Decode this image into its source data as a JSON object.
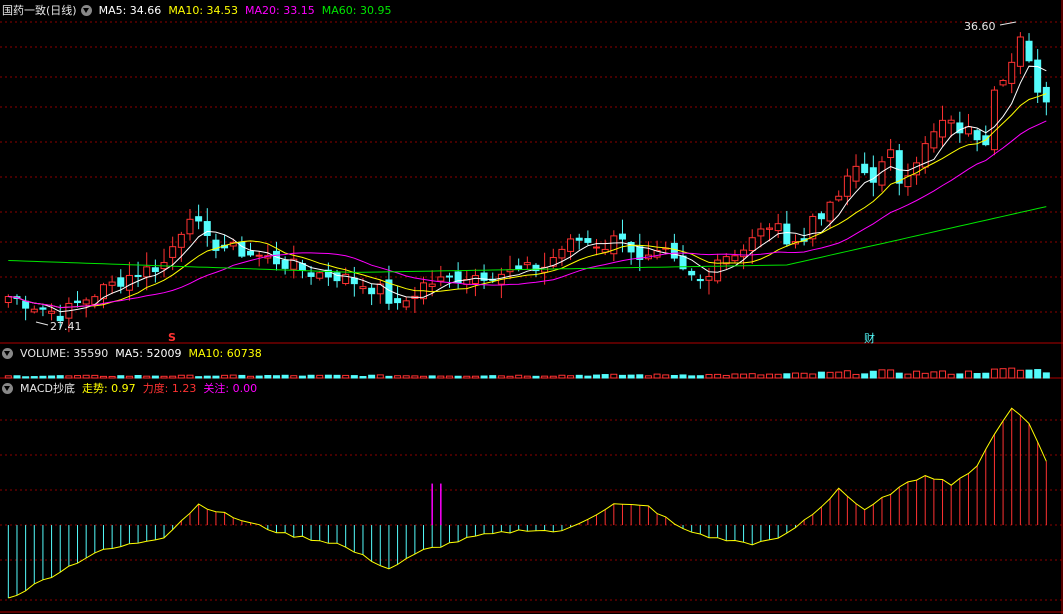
{
  "title": "国药一致(日线)",
  "legend": {
    "ma5": "MA5: 34.66",
    "ma10": "MA10: 34.53",
    "ma20": "MA20: 33.15",
    "ma60": "MA60: 30.95"
  },
  "volume_header": {
    "label": "VOLUME: 35590",
    "ma5": "MA5: 52009",
    "ma10": "MA10: 60738"
  },
  "macd_header": {
    "label": "MACD抄底",
    "trend": "走势: 0.97",
    "force": "力度: 1.23",
    "focus": "关注: 0.00"
  },
  "markers": {
    "high": "36.60",
    "low": "27.41",
    "s": "S",
    "cai": "财"
  },
  "colors": {
    "up": "#ff3232",
    "down": "#54fcfc",
    "ma5": "#ffffff",
    "ma10": "#ffff00",
    "ma20": "#ff00ff",
    "ma60": "#00e600",
    "grid": "#8b0000"
  },
  "chart_data": {
    "type": "candlestick",
    "panes": [
      "price",
      "volume",
      "macd"
    ],
    "price_range": [
      27.41,
      36.6
    ],
    "control_points": [
      [
        0,
        28.1
      ],
      [
        6,
        27.5
      ],
      [
        10,
        28.2
      ],
      [
        14,
        28.8
      ],
      [
        18,
        29.2
      ],
      [
        21,
        30.9
      ],
      [
        23,
        29.9
      ],
      [
        27,
        29.6
      ],
      [
        31,
        29.3
      ],
      [
        35,
        28.9
      ],
      [
        38,
        28.8
      ],
      [
        43,
        28.3
      ],
      [
        45,
        27.7
      ],
      [
        48,
        28.5
      ],
      [
        53,
        28.8
      ],
      [
        58,
        28.9
      ],
      [
        62,
        29.1
      ],
      [
        64,
        29.7
      ],
      [
        66,
        30.0
      ],
      [
        69,
        29.8
      ],
      [
        71,
        30.2
      ],
      [
        73,
        29.2
      ],
      [
        76,
        29.5
      ],
      [
        78,
        28.9
      ],
      [
        80,
        28.6
      ],
      [
        82,
        29.4
      ],
      [
        85,
        29.7
      ],
      [
        88,
        30.5
      ],
      [
        90,
        30.1
      ],
      [
        92,
        29.9
      ],
      [
        93,
        30.8
      ],
      [
        95,
        31.0
      ],
      [
        98,
        32.4
      ],
      [
        100,
        32.1
      ],
      [
        102,
        32.8
      ],
      [
        103,
        32.0
      ],
      [
        106,
        33.1
      ],
      [
        108,
        33.9
      ],
      [
        110,
        33.7
      ],
      [
        113,
        33.4
      ],
      [
        114,
        35.2
      ],
      [
        116,
        35.9
      ],
      [
        117,
        36.6
      ],
      [
        118,
        35.8
      ],
      [
        119,
        35.1
      ],
      [
        120,
        34.6
      ]
    ],
    "volume": {
      "last": 35590,
      "ma5": 52009,
      "ma10": 60738,
      "shape": [
        [
          0,
          0.12
        ],
        [
          60,
          0.15
        ],
        [
          90,
          0.22
        ],
        [
          100,
          0.38
        ],
        [
          110,
          0.32
        ],
        [
          116,
          0.5
        ],
        [
          120,
          0.45
        ]
      ]
    },
    "macd": {
      "trend": 0.97,
      "force": 1.23,
      "focus": 0.0,
      "line": [
        [
          0,
          -3.2
        ],
        [
          5,
          -2.2
        ],
        [
          10,
          -1.2
        ],
        [
          18,
          -0.5
        ],
        [
          22,
          0.9
        ],
        [
          27,
          0.2
        ],
        [
          32,
          -0.4
        ],
        [
          38,
          -0.8
        ],
        [
          44,
          -1.9
        ],
        [
          48,
          -1.1
        ],
        [
          54,
          -0.5
        ],
        [
          60,
          -0.2
        ],
        [
          64,
          -0.3
        ],
        [
          68,
          0.5
        ],
        [
          70,
          0.9
        ],
        [
          74,
          0.8
        ],
        [
          78,
          -0.2
        ],
        [
          82,
          -0.6
        ],
        [
          86,
          -0.8
        ],
        [
          88,
          -0.7
        ],
        [
          90,
          -0.4
        ],
        [
          94,
          0.8
        ],
        [
          96,
          1.6
        ],
        [
          99,
          0.6
        ],
        [
          102,
          1.4
        ],
        [
          104,
          1.8
        ],
        [
          106,
          2.2
        ],
        [
          109,
          1.8
        ],
        [
          112,
          2.5
        ],
        [
          114,
          4.0
        ],
        [
          116,
          5.1
        ],
        [
          118,
          4.4
        ],
        [
          120,
          2.8
        ]
      ],
      "range": [
        -3.6,
        5.6
      ],
      "zero": 0
    }
  }
}
